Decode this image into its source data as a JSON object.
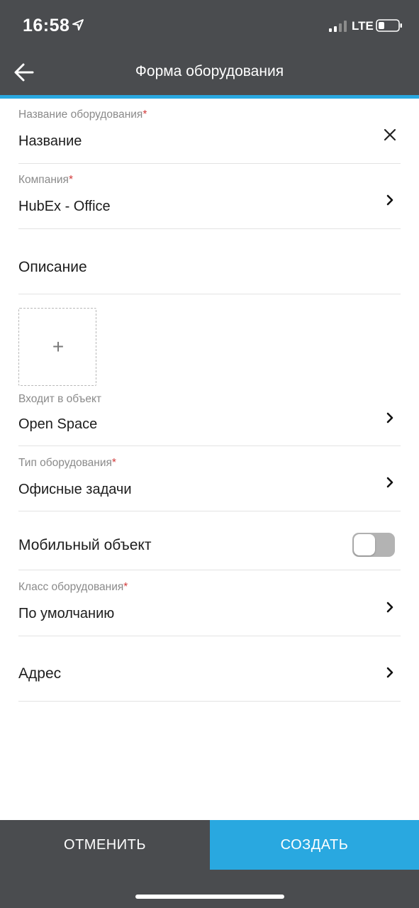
{
  "status_bar": {
    "time": "16:58",
    "network": "LTE"
  },
  "header": {
    "title": "Форма оборудования"
  },
  "form": {
    "name": {
      "label": "Название оборудования",
      "required": "*",
      "value": "Название"
    },
    "company": {
      "label": "Компания",
      "required": "*",
      "value": "HubEx - Office"
    },
    "description": {
      "label": "Описание"
    },
    "photo": {
      "add_symbol": "+"
    },
    "parent": {
      "label": "Входит в объект",
      "value": "Open Space"
    },
    "type": {
      "label": "Тип оборудования",
      "required": "*",
      "value": "Офисные задачи"
    },
    "mobile": {
      "label": "Мобильный объект",
      "enabled": false
    },
    "equipment_class": {
      "label": "Класс оборудования",
      "required": "*",
      "value": "По умолчанию"
    },
    "address": {
      "label": "Адрес"
    }
  },
  "buttons": {
    "cancel": "ОТМЕНИТЬ",
    "create": "СОЗДАТЬ"
  },
  "colors": {
    "header_bg": "#4a4c4f",
    "accent": "#29a8e0",
    "required": "#d23b3b"
  }
}
